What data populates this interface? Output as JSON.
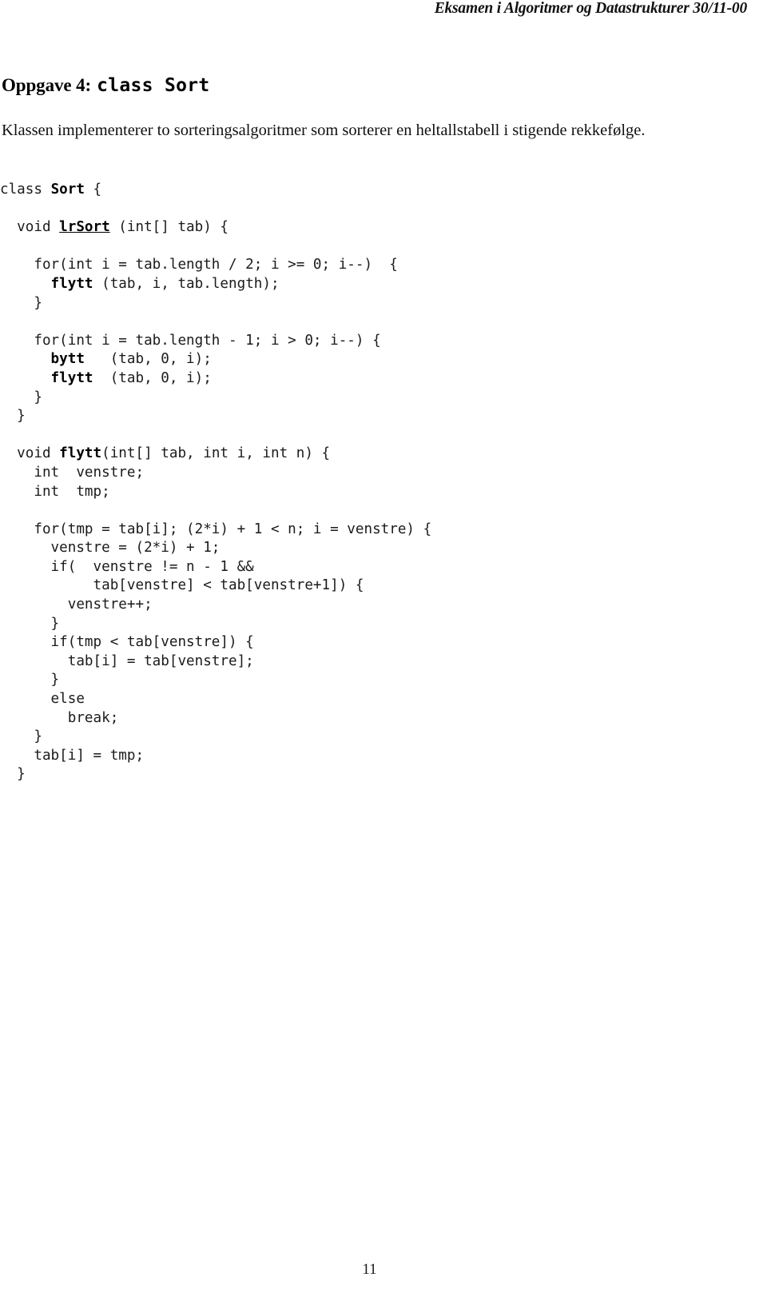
{
  "document": {
    "running_header": "Eksamen i Algoritmer og Datastrukturer 30/11-00",
    "page_number": "11",
    "colors": {
      "page_background": "#ffffff",
      "body_text": "#1a1a1a",
      "code_text": "#1b1b1b",
      "heading_text": "#000000"
    }
  },
  "heading": {
    "label": "Oppgave 4:",
    "code_title": "class Sort"
  },
  "intro": {
    "text": "Klassen implementerer to sorteringsalgoritmer som sorterer en heltallstabell i stigende rekkefølge."
  },
  "code": {
    "language": "java",
    "lines": [
      {
        "indent": 0,
        "segments": [
          {
            "t": "class ",
            "s": "plain"
          },
          {
            "t": "Sort",
            "s": "bold"
          },
          {
            "t": " {",
            "s": "plain"
          }
        ]
      },
      {
        "indent": 0,
        "segments": [
          {
            "t": "",
            "s": "plain"
          }
        ]
      },
      {
        "indent": 2,
        "segments": [
          {
            "t": "void ",
            "s": "plain"
          },
          {
            "t": "lrSort",
            "s": "bold-underline"
          },
          {
            "t": " (int[] tab) {",
            "s": "plain"
          }
        ]
      },
      {
        "indent": 0,
        "segments": [
          {
            "t": "",
            "s": "plain"
          }
        ]
      },
      {
        "indent": 4,
        "segments": [
          {
            "t": "for(int i = tab.length / 2; i >= 0; i--)  {",
            "s": "plain"
          }
        ]
      },
      {
        "indent": 6,
        "segments": [
          {
            "t": "flytt",
            "s": "bold"
          },
          {
            "t": " (tab, i, tab.length);",
            "s": "plain"
          }
        ]
      },
      {
        "indent": 4,
        "segments": [
          {
            "t": "}",
            "s": "plain"
          }
        ]
      },
      {
        "indent": 0,
        "segments": [
          {
            "t": "",
            "s": "plain"
          }
        ]
      },
      {
        "indent": 4,
        "segments": [
          {
            "t": "for(int i = tab.length - 1; i > 0; i--) {",
            "s": "plain"
          }
        ]
      },
      {
        "indent": 6,
        "segments": [
          {
            "t": "bytt",
            "s": "bold"
          },
          {
            "t": "   (tab, 0, i);",
            "s": "plain"
          }
        ]
      },
      {
        "indent": 6,
        "segments": [
          {
            "t": "flytt",
            "s": "bold"
          },
          {
            "t": "  (tab, 0, i);",
            "s": "plain"
          }
        ]
      },
      {
        "indent": 4,
        "segments": [
          {
            "t": "}",
            "s": "plain"
          }
        ]
      },
      {
        "indent": 2,
        "segments": [
          {
            "t": "}",
            "s": "plain"
          }
        ]
      },
      {
        "indent": 0,
        "segments": [
          {
            "t": "",
            "s": "plain"
          }
        ]
      },
      {
        "indent": 2,
        "segments": [
          {
            "t": "void ",
            "s": "plain"
          },
          {
            "t": "flytt",
            "s": "bold"
          },
          {
            "t": "(int[] tab, int i, int n) {",
            "s": "plain"
          }
        ]
      },
      {
        "indent": 4,
        "segments": [
          {
            "t": "int  venstre;",
            "s": "plain"
          }
        ]
      },
      {
        "indent": 4,
        "segments": [
          {
            "t": "int  tmp;",
            "s": "plain"
          }
        ]
      },
      {
        "indent": 0,
        "segments": [
          {
            "t": "",
            "s": "plain"
          }
        ]
      },
      {
        "indent": 4,
        "segments": [
          {
            "t": "for(tmp = tab[i]; (2*i) + 1 < n; i = venstre) {",
            "s": "plain"
          }
        ]
      },
      {
        "indent": 6,
        "segments": [
          {
            "t": "venstre = (2*i) + 1;",
            "s": "plain"
          }
        ]
      },
      {
        "indent": 6,
        "segments": [
          {
            "t": "if(  venstre != n - 1 &&",
            "s": "plain"
          }
        ]
      },
      {
        "indent": 11,
        "segments": [
          {
            "t": "tab[venstre] < tab[venstre+1]) {",
            "s": "plain"
          }
        ]
      },
      {
        "indent": 8,
        "segments": [
          {
            "t": "venstre++;",
            "s": "plain"
          }
        ]
      },
      {
        "indent": 6,
        "segments": [
          {
            "t": "}",
            "s": "plain"
          }
        ]
      },
      {
        "indent": 6,
        "segments": [
          {
            "t": "if(tmp < tab[venstre]) {",
            "s": "plain"
          }
        ]
      },
      {
        "indent": 8,
        "segments": [
          {
            "t": "tab[i] = tab[venstre];",
            "s": "plain"
          }
        ]
      },
      {
        "indent": 6,
        "segments": [
          {
            "t": "}",
            "s": "plain"
          }
        ]
      },
      {
        "indent": 6,
        "segments": [
          {
            "t": "else",
            "s": "plain"
          }
        ]
      },
      {
        "indent": 8,
        "segments": [
          {
            "t": "break;",
            "s": "plain"
          }
        ]
      },
      {
        "indent": 4,
        "segments": [
          {
            "t": "}",
            "s": "plain"
          }
        ]
      },
      {
        "indent": 4,
        "segments": [
          {
            "t": "tab[i] = tmp;",
            "s": "plain"
          }
        ]
      },
      {
        "indent": 2,
        "segments": [
          {
            "t": "}",
            "s": "plain"
          }
        ]
      }
    ]
  }
}
